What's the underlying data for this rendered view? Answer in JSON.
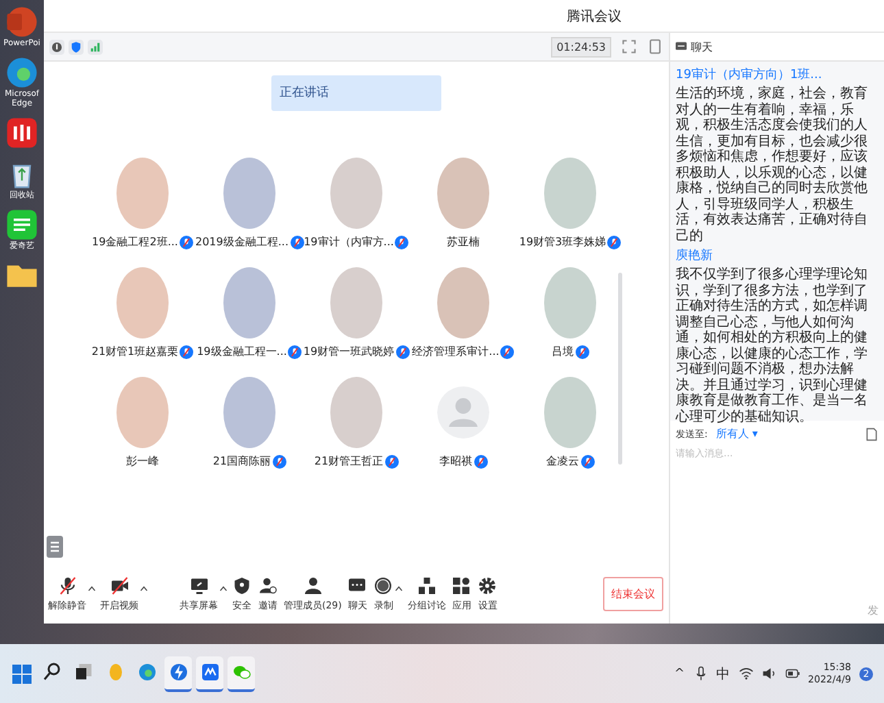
{
  "desktop": {
    "icons": [
      {
        "kind": "powerpoint",
        "label": "PowerPoi"
      },
      {
        "kind": "edge",
        "label": "Microsof Edge"
      },
      {
        "kind": "music"
      },
      {
        "kind": "recycle",
        "label": "回收站"
      },
      {
        "kind": "iqiyi",
        "label": "爱奇艺"
      },
      {
        "kind": "folder"
      }
    ]
  },
  "window": {
    "title": "腾讯会议",
    "timer": "01:24:53"
  },
  "speaking_toast": "正在讲话",
  "participants": [
    {
      "name": "19金融工程2班...",
      "kind": "photo",
      "muted": true
    },
    {
      "name": "2019级金融工程...",
      "kind": "photo",
      "muted": true
    },
    {
      "name": "19审计（内审方...",
      "kind": "photo",
      "muted": true
    },
    {
      "name": "苏亚楠",
      "kind": "photo",
      "muted": false
    },
    {
      "name": "19财管3班李姝娣",
      "kind": "photo",
      "muted": true
    },
    {
      "name": "21财管1班赵嘉栗",
      "kind": "photo",
      "muted": true
    },
    {
      "name": "19级金融工程一...",
      "kind": "photo",
      "muted": true
    },
    {
      "name": "19财管一班武晓婷",
      "kind": "photo",
      "muted": true
    },
    {
      "name": "经济管理系审计...",
      "kind": "photo",
      "muted": true
    },
    {
      "name": "吕境",
      "kind": "photo",
      "muted": true
    },
    {
      "name": "彭一峰",
      "kind": "photo",
      "muted": false
    },
    {
      "name": "21国商陈丽",
      "kind": "photo",
      "muted": true
    },
    {
      "name": "21财管王哲正",
      "kind": "photo",
      "muted": true
    },
    {
      "name": "李昭祺",
      "kind": "default",
      "muted": true
    },
    {
      "name": "金凌云",
      "kind": "photo",
      "muted": true
    }
  ],
  "toolbar": [
    {
      "kind": "mic",
      "label": "解除静音",
      "off": true,
      "menu": true
    },
    {
      "kind": "camera",
      "label": "开启视频",
      "off": true,
      "menu": true
    },
    {
      "kind": "share",
      "label": "共享屏幕",
      "off": false,
      "menu": true
    },
    {
      "kind": "security",
      "label": "安全",
      "off": false,
      "menu": false
    },
    {
      "kind": "invite",
      "label": "邀请",
      "off": false,
      "menu": false
    },
    {
      "kind": "members",
      "label": "管理成员(29)",
      "off": false,
      "menu": false
    },
    {
      "kind": "chat",
      "label": "聊天",
      "off": false,
      "menu": false
    },
    {
      "kind": "record",
      "label": "录制",
      "off": false,
      "menu": true
    },
    {
      "kind": "breakout",
      "label": "分组讨论",
      "off": false,
      "menu": false
    },
    {
      "kind": "apps",
      "label": "应用",
      "off": false,
      "menu": false
    },
    {
      "kind": "settings",
      "label": "设置",
      "off": false,
      "menu": false
    }
  ],
  "end_button": "结束会议",
  "chat": {
    "title": "聊天",
    "messages": [
      {
        "sender": "19审计（内审方向）1班...",
        "text": "生活的环境，家庭，社会，教育对人的一生有着响，幸福，乐观，积极生活态度会使我们的人生信，更加有目标，也会减少很多烦恼和焦虑，作想要好，应该积极助人，以乐观的心态，以健康格，悦纳自己的同时去欣赏他人，引导班级同学人，积极生活，有效表达痛苦，正确对待自己的"
      },
      {
        "sender": "庾艳新",
        "text": "我不仅学到了很多心理学理论知识，学到了很多方法，也学到了正确对待生活的方式，如怎样调调整自己心态，与他人如何沟通，如何相处的方积极向上的健康心态，以健康的心态工作，学习碰到问题不消极，想办法解决。并且通过学习，识到心理健康教育是做教育工作、是当一名心理可少的基础知识。"
      }
    ],
    "send_to_label": "发送至:",
    "recipient": "所有人 ▾",
    "placeholder": "请输入消息...",
    "send": "发"
  },
  "taskbar": {
    "apps": [
      {
        "kind": "search",
        "selected": false
      },
      {
        "kind": "taskview",
        "selected": false
      },
      {
        "kind": "browser-yellow",
        "selected": false
      },
      {
        "kind": "edge",
        "selected": false
      },
      {
        "kind": "bolt",
        "selected": true
      },
      {
        "kind": "meeting",
        "selected": true
      },
      {
        "kind": "wechat",
        "selected": true
      }
    ],
    "overflow_caret": "^",
    "ime": "中",
    "time": "15:38",
    "date": "2022/4/9",
    "notifications": "2"
  }
}
